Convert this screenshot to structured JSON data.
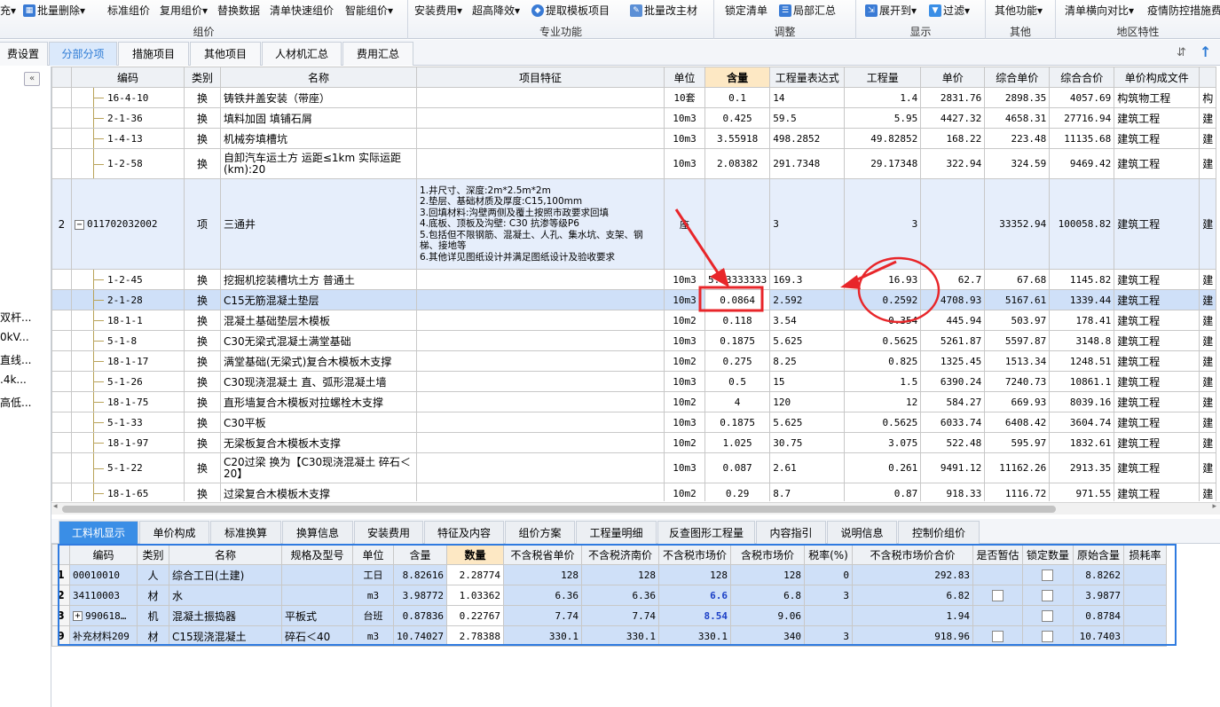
{
  "ribbon": {
    "groups": [
      {
        "label": "组价",
        "buttons": [
          "充▾",
          "批量删除▾",
          "标准组价",
          "复用组价▾",
          "替换数据",
          "清单快速组价",
          "智能组价▾"
        ]
      },
      {
        "label": "专业功能",
        "buttons": [
          "安装费用▾",
          "超高降效▾",
          "提取模板项目",
          "批量改主材"
        ]
      },
      {
        "label": "调整",
        "buttons": [
          "锁定清单",
          "局部汇总"
        ]
      },
      {
        "label": "显示",
        "buttons": [
          "展开到▾",
          "过滤▾"
        ]
      },
      {
        "label": "其他",
        "buttons": [
          "其他功能▾"
        ]
      },
      {
        "label": "地区特性",
        "buttons": [
          "清单横向对比▾",
          "疫情防控措施费"
        ]
      }
    ]
  },
  "tabs": [
    "费设置",
    "分部分项",
    "措施项目",
    "其他项目",
    "人材机汇总",
    "费用汇总"
  ],
  "active_tab": "分部分项",
  "left_panel": {
    "items": [
      "双杆...",
      "0kV...",
      "直线...",
      ".4k...",
      "高低..."
    ]
  },
  "main_grid": {
    "headers": [
      "编码",
      "类别",
      "名称",
      "项目特征",
      "单位",
      "含量",
      "工程量表达式",
      "工程量",
      "单价",
      "综合单价",
      "综合合价",
      "单价构成文件",
      ""
    ],
    "rows": [
      {
        "num": "",
        "code": "16-4-10",
        "type": "换",
        "name": "铸铁井盖安装（带座）",
        "feature": "",
        "unit": "10套",
        "content": "0.1",
        "expr": "14",
        "qty": "1.4",
        "price": "2831.76",
        "uprice": "2898.35",
        "total": "4057.69",
        "file": "构筑物工程",
        "extra": "构"
      },
      {
        "num": "",
        "code": "2-1-36",
        "type": "换",
        "name": "填料加固 填铺石屑",
        "feature": "",
        "unit": "10m3",
        "content": "0.425",
        "expr": "59.5",
        "qty": "5.95",
        "price": "4427.32",
        "uprice": "4658.31",
        "total": "27716.94",
        "file": "建筑工程",
        "extra": "建"
      },
      {
        "num": "",
        "code": "1-4-13",
        "type": "换",
        "name": "机械夯填槽坑",
        "feature": "",
        "unit": "10m3",
        "content": "3.55918",
        "expr": "498.2852",
        "qty": "49.82852",
        "price": "168.22",
        "uprice": "223.48",
        "total": "11135.68",
        "file": "建筑工程",
        "extra": "建"
      },
      {
        "num": "",
        "code": "1-2-58",
        "type": "换",
        "name": "自卸汽车运土方 运距≤1km  实际运距(km):20",
        "feature": "",
        "unit": "10m3",
        "content": "2.08382",
        "expr": "291.7348",
        "qty": "29.17348",
        "price": "322.94",
        "uprice": "324.59",
        "total": "9469.42",
        "file": "建筑工程",
        "extra": "建"
      },
      {
        "num": "2",
        "code": "011702032002",
        "type": "项",
        "name": "三通井",
        "feature": "1.井尺寸、深度:2m*2.5m*2m\n2.垫层、基础材质及厚度:C15,100mm\n3.回填材料:沟壁两侧及覆土按照市政要求回填\n4.底板、顶板及沟壁: C30 抗渗等级P6\n5.包括但不限钢筋、混凝土、人孔、集水坑、支架、钢梯、接地等\n6.其他详见图纸设计并满足图纸设计及验收要求",
        "unit": "座",
        "content": "",
        "expr": "3",
        "qty": "3",
        "price": "",
        "uprice": "33352.94",
        "total": "100058.82",
        "file": "建筑工程",
        "extra": "建"
      },
      {
        "num": "",
        "code": "1-2-45",
        "type": "换",
        "name": "挖掘机挖装槽坑土方 普通土",
        "feature": "",
        "unit": "10m3",
        "content": "5.63333333",
        "expr": "169.3",
        "qty": "16.93",
        "price": "62.7",
        "uprice": "67.68",
        "total": "1145.82",
        "file": "建筑工程",
        "extra": "建"
      },
      {
        "num": "",
        "code": "2-1-28",
        "type": "换",
        "name": "C15无筋混凝土垫层",
        "feature": "",
        "unit": "10m3",
        "content": "0.0864",
        "expr": "2.592",
        "qty": "0.2592",
        "price": "4708.93",
        "uprice": "5167.61",
        "total": "1339.44",
        "file": "建筑工程",
        "extra": "建"
      },
      {
        "num": "",
        "code": "18-1-1",
        "type": "换",
        "name": "混凝土基础垫层木模板",
        "feature": "",
        "unit": "10m2",
        "content": "0.118",
        "expr": "3.54",
        "qty": "0.354",
        "price": "445.94",
        "uprice": "503.97",
        "total": "178.41",
        "file": "建筑工程",
        "extra": "建"
      },
      {
        "num": "",
        "code": "5-1-8",
        "type": "换",
        "name": "C30无梁式混凝土满堂基础",
        "feature": "",
        "unit": "10m3",
        "content": "0.1875",
        "expr": "5.625",
        "qty": "0.5625",
        "price": "5261.87",
        "uprice": "5597.87",
        "total": "3148.8",
        "file": "建筑工程",
        "extra": "建"
      },
      {
        "num": "",
        "code": "18-1-17",
        "type": "换",
        "name": "满堂基础(无梁式)复合木模板木支撑",
        "feature": "",
        "unit": "10m2",
        "content": "0.275",
        "expr": "8.25",
        "qty": "0.825",
        "price": "1325.45",
        "uprice": "1513.34",
        "total": "1248.51",
        "file": "建筑工程",
        "extra": "建"
      },
      {
        "num": "",
        "code": "5-1-26",
        "type": "换",
        "name": "C30现浇混凝土 直、弧形混凝土墙",
        "feature": "",
        "unit": "10m3",
        "content": "0.5",
        "expr": "15",
        "qty": "1.5",
        "price": "6390.24",
        "uprice": "7240.73",
        "total": "10861.1",
        "file": "建筑工程",
        "extra": "建"
      },
      {
        "num": "",
        "code": "18-1-75",
        "type": "换",
        "name": "直形墙复合木模板对拉螺栓木支撑",
        "feature": "",
        "unit": "10m2",
        "content": "4",
        "expr": "120",
        "qty": "12",
        "price": "584.27",
        "uprice": "669.93",
        "total": "8039.16",
        "file": "建筑工程",
        "extra": "建"
      },
      {
        "num": "",
        "code": "5-1-33",
        "type": "换",
        "name": "C30平板",
        "feature": "",
        "unit": "10m3",
        "content": "0.1875",
        "expr": "5.625",
        "qty": "0.5625",
        "price": "6033.74",
        "uprice": "6408.42",
        "total": "3604.74",
        "file": "建筑工程",
        "extra": "建"
      },
      {
        "num": "",
        "code": "18-1-97",
        "type": "换",
        "name": "无梁板复合木模板木支撑",
        "feature": "",
        "unit": "10m2",
        "content": "1.025",
        "expr": "30.75",
        "qty": "3.075",
        "price": "522.48",
        "uprice": "595.97",
        "total": "1832.61",
        "file": "建筑工程",
        "extra": "建"
      },
      {
        "num": "",
        "code": "5-1-22",
        "type": "换",
        "name": "C20过梁  换为【C30现浇混凝土 碎石＜20】",
        "feature": "",
        "unit": "10m3",
        "content": "0.087",
        "expr": "2.61",
        "qty": "0.261",
        "price": "9491.12",
        "uprice": "11162.26",
        "total": "2913.35",
        "file": "建筑工程",
        "extra": "建"
      },
      {
        "num": "",
        "code": "18-1-65",
        "type": "换",
        "name": "过梁复合木模板木支撑",
        "feature": "",
        "unit": "10m2",
        "content": "0.29",
        "expr": "8.7",
        "qty": "0.87",
        "price": "918.33",
        "uprice": "1116.72",
        "total": "971.55",
        "file": "建筑工程",
        "extra": "建"
      }
    ]
  },
  "bottom_tabs": [
    "工料机显示",
    "单价构成",
    "标准换算",
    "换算信息",
    "安装费用",
    "特征及内容",
    "组价方案",
    "工程量明细",
    "反查图形工程量",
    "内容指引",
    "说明信息",
    "控制价组价"
  ],
  "bottom_active": "工料机显示",
  "bottom_grid": {
    "headers": [
      "编码",
      "类别",
      "名称",
      "规格及型号",
      "单位",
      "含量",
      "数量",
      "不含税省单价",
      "不含税济南价",
      "不含税市场价",
      "含税市场价",
      "税率(%)",
      "不含税市场价合价",
      "是否暂估",
      "锁定数量",
      "原始含量",
      "损耗率"
    ],
    "rows": [
      {
        "num": "1",
        "code": "00010010",
        "type": "人",
        "name": "综合工日(土建)",
        "spec": "",
        "unit": "工日",
        "content": "8.82616",
        "qty": "2.28774",
        "p1": "128",
        "p2": "128",
        "p3": "128",
        "p4": "128",
        "tax": "0",
        "sum": "292.83",
        "est": false,
        "lock": true,
        "orig": "8.8262",
        "loss": ""
      },
      {
        "num": "2",
        "code": "34110003",
        "type": "材",
        "name": "水",
        "spec": "",
        "unit": "m3",
        "content": "3.98772",
        "qty": "1.03362",
        "p1": "6.36",
        "p2": "6.36",
        "p3": "6.6",
        "p4": "6.8",
        "tax": "3",
        "sum": "6.82",
        "est": true,
        "lock": true,
        "orig": "3.9877",
        "loss": ""
      },
      {
        "num": "3",
        "code": "990618…",
        "type": "机",
        "name": "混凝土振捣器",
        "spec": "平板式",
        "unit": "台班",
        "content": "0.87836",
        "qty": "0.22767",
        "p1": "7.74",
        "p2": "7.74",
        "p3": "8.54",
        "p4": "9.06",
        "tax": "",
        "sum": "1.94",
        "est": false,
        "lock": true,
        "orig": "0.8784",
        "loss": ""
      },
      {
        "num": "9",
        "code": "补充材料209",
        "type": "材",
        "name": "C15现浇混凝土",
        "spec": "碎石＜40",
        "unit": "m3",
        "content": "10.74027",
        "qty": "2.78388",
        "p1": "330.1",
        "p2": "330.1",
        "p3": "330.1",
        "p4": "340",
        "tax": "3",
        "sum": "918.96",
        "est": true,
        "lock": true,
        "orig": "10.7403",
        "loss": ""
      }
    ]
  },
  "colors": {
    "accent": "#3a8ee6",
    "highlight_header": "#fde8c4",
    "annotation": "#e8262a",
    "selected_row": "#cfe0f8"
  }
}
